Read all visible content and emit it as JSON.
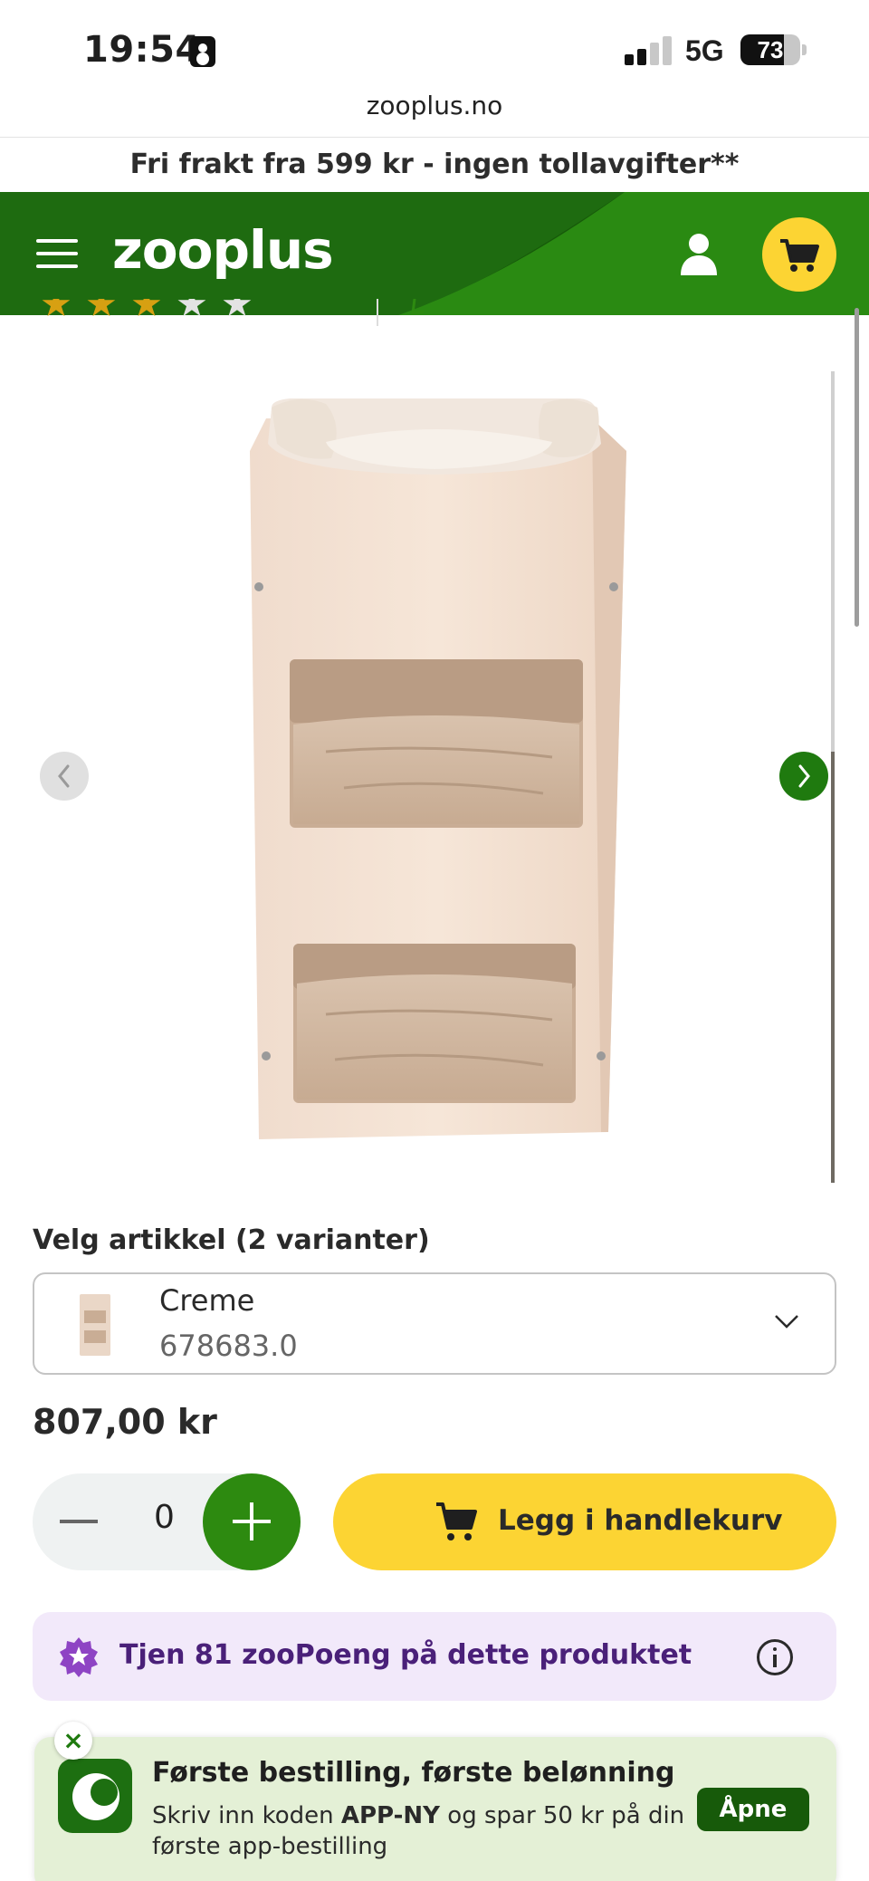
{
  "status_bar": {
    "time": "19:54",
    "network": "5G",
    "battery": "73",
    "battery_level": 0.73
  },
  "browser": {
    "url": "zooplus.no"
  },
  "promo_banner": {
    "text": "Fri frakt fra 599 kr - ingen tollavgifter**"
  },
  "header": {
    "logo": "zooplus",
    "brand_color": "#175a0a",
    "accent_color": "#fcd433"
  },
  "rating": {
    "stars_filled": 3,
    "stars_total": 5
  },
  "gallery": {
    "icons": [
      "chevron-left-icon",
      "chevron-right-icon"
    ]
  },
  "variant": {
    "label": "Velg artikkel (2 varianter)",
    "selected_name": "Creme",
    "selected_sku": "678683.0"
  },
  "price": "807,00 kr",
  "quantity": {
    "value": "0"
  },
  "add_to_cart": {
    "label": "Legg i handlekurv"
  },
  "points": {
    "label": "Tjen 81 zooPoeng på dette produktet"
  },
  "app_banner": {
    "close": "×",
    "title": "Første bestilling, første belønning",
    "text_before": "Skriv inn koden ",
    "code": "APP-NY",
    "text_after": " og spar 50 kr på din første app-bestilling",
    "button": "Åpne"
  }
}
